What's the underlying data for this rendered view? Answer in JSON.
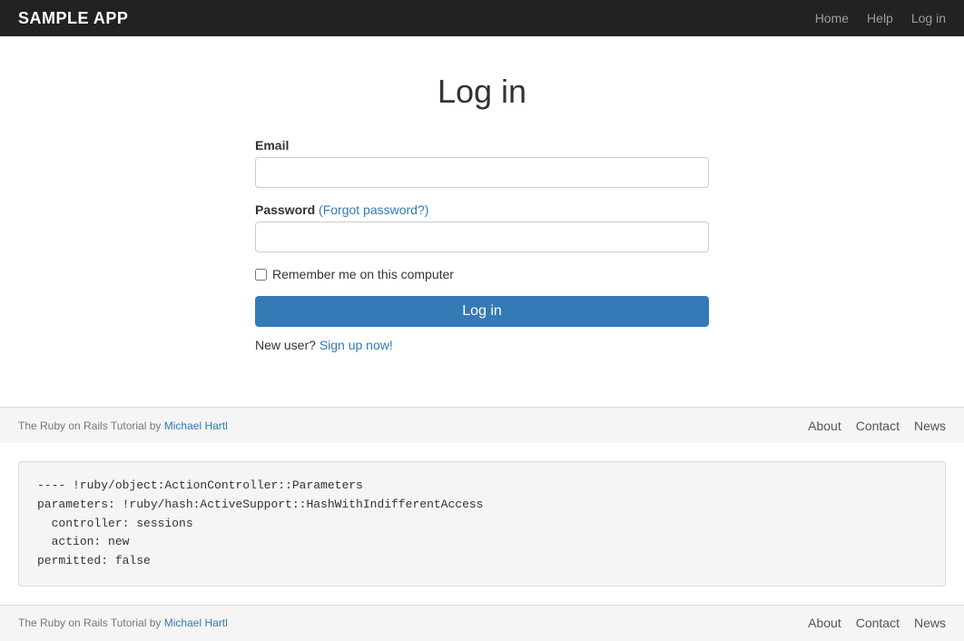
{
  "app": {
    "name": "SAMPLE APP"
  },
  "navbar": {
    "brand": "SAMPLE APP",
    "links": [
      {
        "label": "Home",
        "href": "#"
      },
      {
        "label": "Help",
        "href": "#"
      },
      {
        "label": "Log in",
        "href": "#"
      }
    ]
  },
  "page": {
    "title": "Log in"
  },
  "form": {
    "email_label": "Email",
    "email_placeholder": "",
    "password_label": "Password",
    "password_placeholder": "",
    "forgot_password_label": "(Forgot password?)",
    "remember_me_label": "Remember me on this computer",
    "submit_label": "Log in",
    "new_user_text": "New user?",
    "signup_label": "Sign up now!"
  },
  "footer1": {
    "text_prefix": "The Ruby on Rails Tutorial",
    "text_by": " by ",
    "text_author": "Michael Hartl",
    "links": [
      {
        "label": "About"
      },
      {
        "label": "Contact"
      },
      {
        "label": "News"
      }
    ]
  },
  "debug": {
    "content": "---- !ruby/object:ActionController::Parameters\nparameters: !ruby/hash:ActiveSupport::HashWithIndifferentAccess\n  controller: sessions\n  action: new\npermitted: false"
  },
  "footer2": {
    "text_prefix": "The Ruby on Rails Tutorial",
    "text_by": " by ",
    "text_author": "Michael Hartl",
    "links": [
      {
        "label": "About"
      },
      {
        "label": "Contact"
      },
      {
        "label": "News"
      }
    ]
  }
}
